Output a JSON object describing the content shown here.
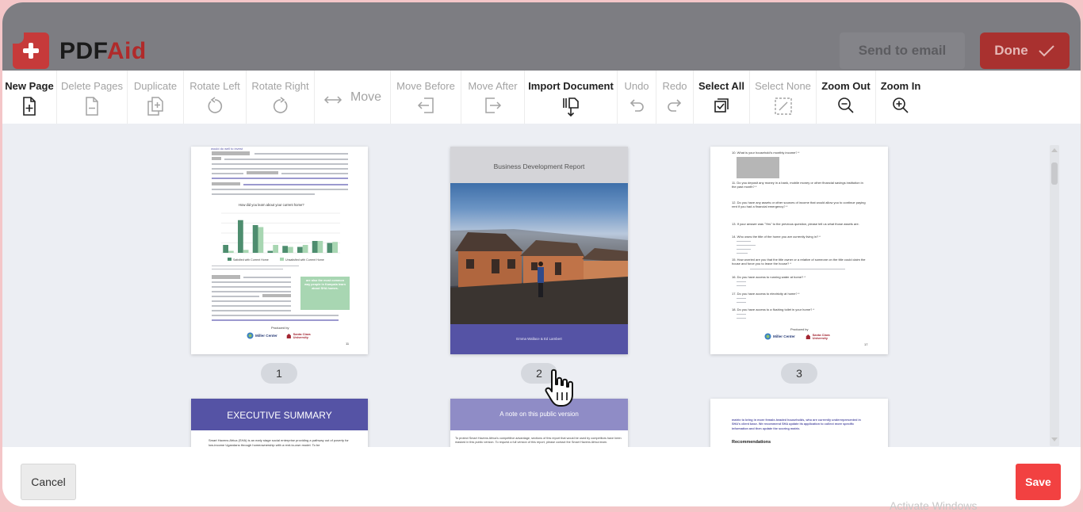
{
  "app": {
    "brand_part1": "PDF",
    "brand_part2": "Aid",
    "send_to_email": "Send to email",
    "done": "Done"
  },
  "toolbar": {
    "new_page": "New Page",
    "delete_pages": "Delete Pages",
    "duplicate": "Duplicate",
    "rotate_left": "Rotate Left",
    "rotate_right": "Rotate Right",
    "move": "Move",
    "move_before": "Move Before",
    "move_after": "Move After",
    "import_document": "Import Document",
    "undo": "Undo",
    "redo": "Redo",
    "select_all": "Select All",
    "select_none": "Select None",
    "zoom_out": "Zoom Out",
    "zoom_in": "Zoom In"
  },
  "pages": [
    {
      "number": "1",
      "link_text": "would do well to invest",
      "chart_title": "How did you learn about your current home?",
      "legend_a": "Satisfied with Current Home",
      "legend_b": "Unsatisfied with Current Home",
      "callout": "are also the most common way people in Kampala learn about SHA homes.",
      "produced_by": "Produced by",
      "logo_a": "Miller Center",
      "logo_b": "Santa Clara University",
      "page_no": "11"
    },
    {
      "number": "2",
      "title": "Business Development Report",
      "authors": "Emma Wallace & Ed Lambert"
    },
    {
      "number": "3",
      "q10": "10. What is your household's monthly income? *",
      "q11": "11. Do you deposit any money in a bank, mobile money or other financial savings institution in the past month? *",
      "q12": "12. Do you have any assets or other sources of income that would allow you to continue paying rent if you had a financial emergency? *",
      "q13": "13. If your answer was \"Yes\" to the previous question, please tell us what those assets are.",
      "q14": "14. Who owns the title of the home you are currently living in? *",
      "q15": "15. How worried are you that the title owner or a relative of someone on the title could claim the house and force you to leave the house? *",
      "q16": "16. Do you have access to running water at home? *",
      "q17": "17. Do you have access to electricity at home? *",
      "q18": "18. Do you have access to a flushing toilet in your home? *",
      "produced_by": "Produced by",
      "logo_a": "Miller Center",
      "logo_b": "Santa Clara University",
      "page_no": "17"
    },
    {
      "title": "EXECUTIVE SUMMARY",
      "body": "Smart Havens Africa (SHA) is an early stage social enterprise providing a pathway out of poverty for low-income Ugandans through homeownership with a rent-to-own model. To be"
    },
    {
      "title": "A note on this public version",
      "body": "To protect Smart Havens Africa's competitive advantage, sections of this report that would be used by competitors have been masked in this public version. To request a full version of this report, please contact the Smart Havens Africa team."
    },
    {
      "body": "matrix to bring in more female-headed households, who are currently underrepresented in SHA's client base. We recommend SHA update its application to collect more specific information and then update the scoring matrix.",
      "heading": "Recommendations"
    }
  ],
  "footer": {
    "cancel": "Cancel",
    "save": "Save",
    "watermark": "Activate Windows"
  },
  "colors": {
    "header_bg": "#7d7d82",
    "brand_red": "#c63a3a",
    "save_red": "#f24141",
    "report_purple": "#5553a5",
    "bar_green": "#4e8d6f",
    "bar_light_green": "#a8d6b2"
  },
  "chart_data": {
    "type": "bar",
    "title": "How did you learn about your current home?",
    "categories": [
      "1",
      "2",
      "3",
      "4",
      "5",
      "6",
      "7",
      "8"
    ],
    "ylim": [
      0,
      40
    ],
    "series": [
      {
        "name": "Satisfied with Current Home",
        "values": [
          8,
          33,
          28,
          2,
          7,
          6,
          12,
          10
        ]
      },
      {
        "name": "Unsatisfied with Current Home",
        "values": [
          2,
          3,
          26,
          8,
          6,
          8,
          12,
          11
        ]
      }
    ]
  }
}
